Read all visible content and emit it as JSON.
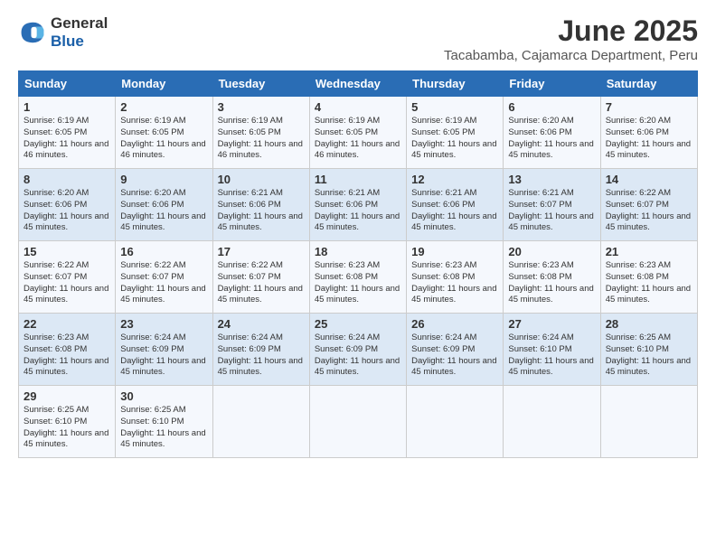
{
  "logo": {
    "general": "General",
    "blue": "Blue"
  },
  "title": {
    "month": "June 2025",
    "location": "Tacabamba, Cajamarca Department, Peru"
  },
  "headers": [
    "Sunday",
    "Monday",
    "Tuesday",
    "Wednesday",
    "Thursday",
    "Friday",
    "Saturday"
  ],
  "weeks": [
    [
      {
        "day": "1",
        "sunrise": "Sunrise: 6:19 AM",
        "sunset": "Sunset: 6:05 PM",
        "daylight": "Daylight: 11 hours and 46 minutes."
      },
      {
        "day": "2",
        "sunrise": "Sunrise: 6:19 AM",
        "sunset": "Sunset: 6:05 PM",
        "daylight": "Daylight: 11 hours and 46 minutes."
      },
      {
        "day": "3",
        "sunrise": "Sunrise: 6:19 AM",
        "sunset": "Sunset: 6:05 PM",
        "daylight": "Daylight: 11 hours and 46 minutes."
      },
      {
        "day": "4",
        "sunrise": "Sunrise: 6:19 AM",
        "sunset": "Sunset: 6:05 PM",
        "daylight": "Daylight: 11 hours and 46 minutes."
      },
      {
        "day": "5",
        "sunrise": "Sunrise: 6:19 AM",
        "sunset": "Sunset: 6:05 PM",
        "daylight": "Daylight: 11 hours and 45 minutes."
      },
      {
        "day": "6",
        "sunrise": "Sunrise: 6:20 AM",
        "sunset": "Sunset: 6:06 PM",
        "daylight": "Daylight: 11 hours and 45 minutes."
      },
      {
        "day": "7",
        "sunrise": "Sunrise: 6:20 AM",
        "sunset": "Sunset: 6:06 PM",
        "daylight": "Daylight: 11 hours and 45 minutes."
      }
    ],
    [
      {
        "day": "8",
        "sunrise": "Sunrise: 6:20 AM",
        "sunset": "Sunset: 6:06 PM",
        "daylight": "Daylight: 11 hours and 45 minutes."
      },
      {
        "day": "9",
        "sunrise": "Sunrise: 6:20 AM",
        "sunset": "Sunset: 6:06 PM",
        "daylight": "Daylight: 11 hours and 45 minutes."
      },
      {
        "day": "10",
        "sunrise": "Sunrise: 6:21 AM",
        "sunset": "Sunset: 6:06 PM",
        "daylight": "Daylight: 11 hours and 45 minutes."
      },
      {
        "day": "11",
        "sunrise": "Sunrise: 6:21 AM",
        "sunset": "Sunset: 6:06 PM",
        "daylight": "Daylight: 11 hours and 45 minutes."
      },
      {
        "day": "12",
        "sunrise": "Sunrise: 6:21 AM",
        "sunset": "Sunset: 6:06 PM",
        "daylight": "Daylight: 11 hours and 45 minutes."
      },
      {
        "day": "13",
        "sunrise": "Sunrise: 6:21 AM",
        "sunset": "Sunset: 6:07 PM",
        "daylight": "Daylight: 11 hours and 45 minutes."
      },
      {
        "day": "14",
        "sunrise": "Sunrise: 6:22 AM",
        "sunset": "Sunset: 6:07 PM",
        "daylight": "Daylight: 11 hours and 45 minutes."
      }
    ],
    [
      {
        "day": "15",
        "sunrise": "Sunrise: 6:22 AM",
        "sunset": "Sunset: 6:07 PM",
        "daylight": "Daylight: 11 hours and 45 minutes."
      },
      {
        "day": "16",
        "sunrise": "Sunrise: 6:22 AM",
        "sunset": "Sunset: 6:07 PM",
        "daylight": "Daylight: 11 hours and 45 minutes."
      },
      {
        "day": "17",
        "sunrise": "Sunrise: 6:22 AM",
        "sunset": "Sunset: 6:07 PM",
        "daylight": "Daylight: 11 hours and 45 minutes."
      },
      {
        "day": "18",
        "sunrise": "Sunrise: 6:23 AM",
        "sunset": "Sunset: 6:08 PM",
        "daylight": "Daylight: 11 hours and 45 minutes."
      },
      {
        "day": "19",
        "sunrise": "Sunrise: 6:23 AM",
        "sunset": "Sunset: 6:08 PM",
        "daylight": "Daylight: 11 hours and 45 minutes."
      },
      {
        "day": "20",
        "sunrise": "Sunrise: 6:23 AM",
        "sunset": "Sunset: 6:08 PM",
        "daylight": "Daylight: 11 hours and 45 minutes."
      },
      {
        "day": "21",
        "sunrise": "Sunrise: 6:23 AM",
        "sunset": "Sunset: 6:08 PM",
        "daylight": "Daylight: 11 hours and 45 minutes."
      }
    ],
    [
      {
        "day": "22",
        "sunrise": "Sunrise: 6:23 AM",
        "sunset": "Sunset: 6:08 PM",
        "daylight": "Daylight: 11 hours and 45 minutes."
      },
      {
        "day": "23",
        "sunrise": "Sunrise: 6:24 AM",
        "sunset": "Sunset: 6:09 PM",
        "daylight": "Daylight: 11 hours and 45 minutes."
      },
      {
        "day": "24",
        "sunrise": "Sunrise: 6:24 AM",
        "sunset": "Sunset: 6:09 PM",
        "daylight": "Daylight: 11 hours and 45 minutes."
      },
      {
        "day": "25",
        "sunrise": "Sunrise: 6:24 AM",
        "sunset": "Sunset: 6:09 PM",
        "daylight": "Daylight: 11 hours and 45 minutes."
      },
      {
        "day": "26",
        "sunrise": "Sunrise: 6:24 AM",
        "sunset": "Sunset: 6:09 PM",
        "daylight": "Daylight: 11 hours and 45 minutes."
      },
      {
        "day": "27",
        "sunrise": "Sunrise: 6:24 AM",
        "sunset": "Sunset: 6:10 PM",
        "daylight": "Daylight: 11 hours and 45 minutes."
      },
      {
        "day": "28",
        "sunrise": "Sunrise: 6:25 AM",
        "sunset": "Sunset: 6:10 PM",
        "daylight": "Daylight: 11 hours and 45 minutes."
      }
    ],
    [
      {
        "day": "29",
        "sunrise": "Sunrise: 6:25 AM",
        "sunset": "Sunset: 6:10 PM",
        "daylight": "Daylight: 11 hours and 45 minutes."
      },
      {
        "day": "30",
        "sunrise": "Sunrise: 6:25 AM",
        "sunset": "Sunset: 6:10 PM",
        "daylight": "Daylight: 11 hours and 45 minutes."
      },
      null,
      null,
      null,
      null,
      null
    ]
  ]
}
